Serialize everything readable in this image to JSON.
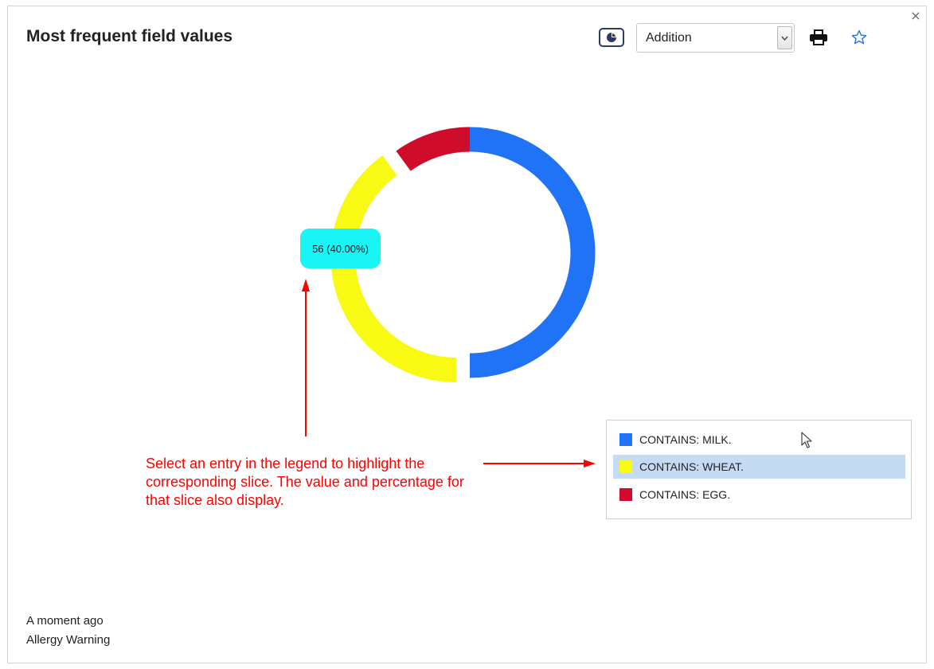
{
  "window": {
    "title": "Most frequent field values",
    "close_glyph": "×"
  },
  "toolbar": {
    "chart_type_icon": "pie-chart-icon",
    "select_value": "Addition",
    "print_icon": "printer-icon",
    "favorite_icon": "star-outline-icon"
  },
  "chart_data": {
    "type": "pie",
    "style": "donut",
    "slices": [
      {
        "label": "CONTAINS: MILK.",
        "value": null,
        "percent": 50.0,
        "color": "#2173f5"
      },
      {
        "label": "CONTAINS: WHEAT.",
        "value": 56,
        "percent": 40.0,
        "color": "#f9fa14"
      },
      {
        "label": "CONTAINS: EGG.",
        "value": null,
        "percent": 10.0,
        "color": "#cf0c2c"
      }
    ],
    "highlighted_label": "56 (40.00%)",
    "highlighted_index": 1
  },
  "legend": {
    "items": [
      {
        "label": "CONTAINS: MILK.",
        "color": "#2173f5",
        "selected": false
      },
      {
        "label": "CONTAINS: WHEAT.",
        "color": "#f9fa14",
        "selected": true
      },
      {
        "label": "CONTAINS: EGG.",
        "color": "#cf0c2c",
        "selected": false
      }
    ]
  },
  "annotation": {
    "text": "Select an entry in the legend to highlight the corresponding slice. The value and percentage for that slice also display.",
    "color": "#ff0000"
  },
  "footer": {
    "time": "A moment ago",
    "subtitle": "Allergy Warning"
  }
}
